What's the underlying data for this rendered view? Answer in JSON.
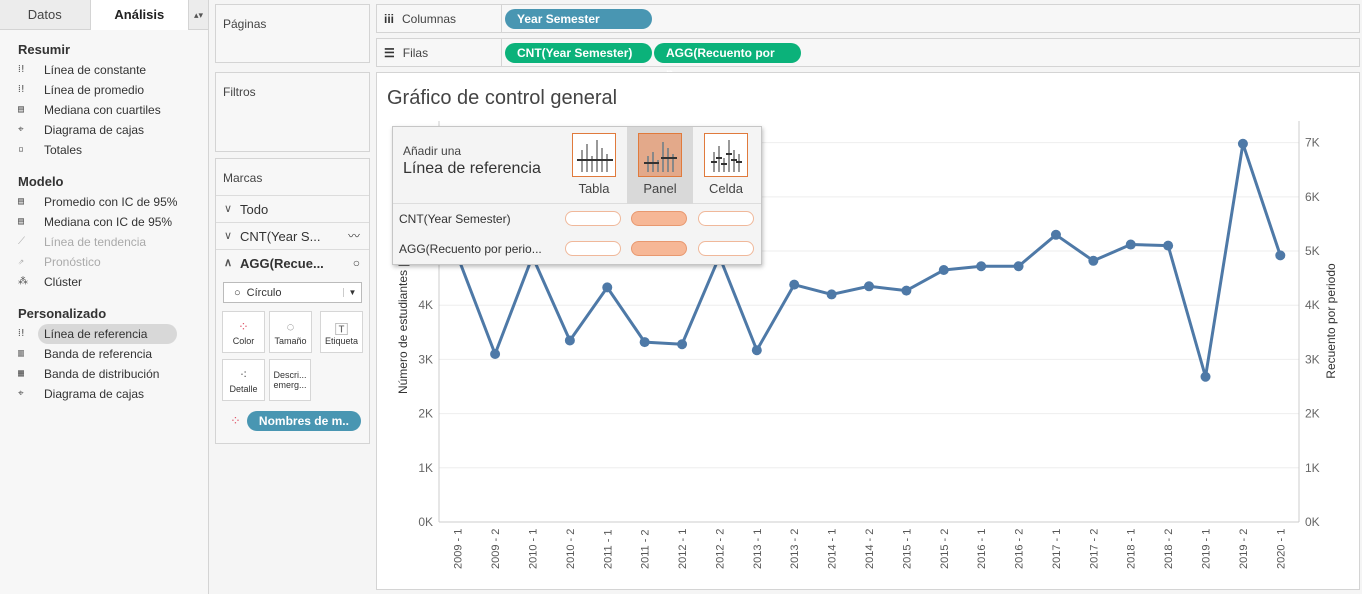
{
  "tabs": {
    "datos": "Datos",
    "analisis": "Análisis"
  },
  "resumir": {
    "title": "Resumir",
    "items": [
      {
        "label": "Línea de constante",
        "icon": "constant-line-icon"
      },
      {
        "label": "Línea de promedio",
        "icon": "average-line-icon"
      },
      {
        "label": "Mediana con cuartiles",
        "icon": "median-quartiles-icon"
      },
      {
        "label": "Diagrama de cajas",
        "icon": "box-plot-icon"
      },
      {
        "label": "Totales",
        "icon": "totals-icon"
      }
    ]
  },
  "modelo": {
    "title": "Modelo",
    "items": [
      {
        "label": "Promedio con IC de 95%",
        "icon": "average-ci-icon"
      },
      {
        "label": "Mediana con IC de 95%",
        "icon": "median-ci-icon"
      },
      {
        "label": "Línea de tendencia",
        "icon": "trend-line-icon"
      },
      {
        "label": "Pronóstico",
        "icon": "forecast-icon"
      },
      {
        "label": "Clúster",
        "icon": "cluster-icon"
      }
    ]
  },
  "personalizado": {
    "title": "Personalizado",
    "items": [
      {
        "label": "Línea de referencia",
        "icon": "reference-line-icon"
      },
      {
        "label": "Banda de referencia",
        "icon": "reference-band-icon"
      },
      {
        "label": "Banda de distribución",
        "icon": "distribution-band-icon"
      },
      {
        "label": "Diagrama de cajas",
        "icon": "box-plot-icon"
      }
    ]
  },
  "cards": {
    "paginas": "Páginas",
    "filtros": "Filtros",
    "marcas": "Marcas"
  },
  "marks": {
    "todo": "Todo",
    "cnt": "CNT(Year S...",
    "agg": "AGG(Recue...",
    "mark_type": "Círculo",
    "buttons": {
      "color": "Color",
      "tamano": "Tamaño",
      "etiqueta": "Etiqueta",
      "detalle": "Detalle",
      "descripcion": "Descri... emerg..."
    },
    "color_pill": "Nombres de m.."
  },
  "shelves": {
    "columnas": "Columnas",
    "filas": "Filas",
    "col_pill": "Year Semester",
    "row_pill_1": "CNT(Year Semester)",
    "row_pill_2": "AGG(Recuento por p.."
  },
  "overlay": {
    "prompt_small": "Añadir una",
    "prompt_big": "Línea de referencia",
    "options": [
      "Tabla",
      "Panel",
      "Celda"
    ],
    "selected": "Panel",
    "rows": [
      "CNT(Year Semester)",
      "AGG(Recuento por perio..."
    ]
  },
  "chart_data": {
    "type": "line",
    "title": "Gráfico de control general",
    "ylabel": "Número de estudiantes [K]",
    "y2label": "Recuento por periodo",
    "ylim": [
      0,
      7400
    ],
    "y_ticks": [
      "0K",
      "1K",
      "2K",
      "3K",
      "4K",
      "5K",
      "6K",
      "7K"
    ],
    "categories": [
      "2009 - 1",
      "2009 - 2",
      "2010 - 1",
      "2010 - 2",
      "2011 - 1",
      "2011 - 2",
      "2012 - 1",
      "2012 - 2",
      "2013 - 1",
      "2013 - 2",
      "2014 - 1",
      "2014 - 2",
      "2015 - 1",
      "2015 - 2",
      "2016 - 1",
      "2016 - 2",
      "2017 - 1",
      "2017 - 2",
      "2018 - 1",
      "2018 - 2",
      "2019 - 1",
      "2019 - 2",
      "2020 - 1"
    ],
    "values": [
      4900,
      3100,
      4900,
      3350,
      4330,
      3320,
      3280,
      4900,
      3170,
      4380,
      4200,
      4350,
      4270,
      4650,
      4720,
      4720,
      5300,
      4820,
      5120,
      5100,
      2680,
      6980,
      4920
    ],
    "line_color": "#4e79a7"
  }
}
